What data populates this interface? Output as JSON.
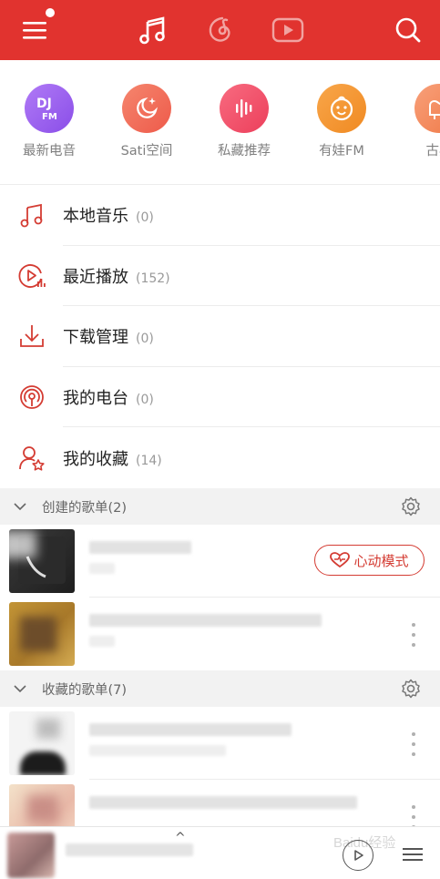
{
  "header": {
    "tabs": [
      {
        "name": "music-note-icon",
        "active": true
      },
      {
        "name": "netease-cloud-icon",
        "active": false
      },
      {
        "name": "video-play-icon",
        "active": false
      }
    ],
    "accent": "#e1332f"
  },
  "quick_entries": [
    {
      "label": "最新电音",
      "icon": "dj-fm-icon",
      "color": "#9a5ef0"
    },
    {
      "label": "Sati空间",
      "icon": "moon-sparkle-icon",
      "color": "#f06c5a"
    },
    {
      "label": "私藏推荐",
      "icon": "soundwave-icon",
      "color": "#f2526a"
    },
    {
      "label": "有娃FM",
      "icon": "baby-face-icon",
      "color": "#f59334"
    },
    {
      "label": "古典",
      "icon": "piano-icon",
      "color": "#f48a5a"
    }
  ],
  "my_music": [
    {
      "label": "本地音乐",
      "count": "(0)",
      "icon": "music-note-icon"
    },
    {
      "label": "最近播放",
      "count": "(152)",
      "icon": "recent-play-icon"
    },
    {
      "label": "下载管理",
      "count": "(0)",
      "icon": "download-icon"
    },
    {
      "label": "我的电台",
      "count": "(0)",
      "icon": "radio-icon"
    },
    {
      "label": "我的收藏",
      "count": "(14)",
      "icon": "favorite-user-icon"
    }
  ],
  "sections": {
    "created": "创建的歌单(2)",
    "collected": "收藏的歌单(7)"
  },
  "heart_mode_label": "心动模式",
  "watermark": "Baidu经验"
}
